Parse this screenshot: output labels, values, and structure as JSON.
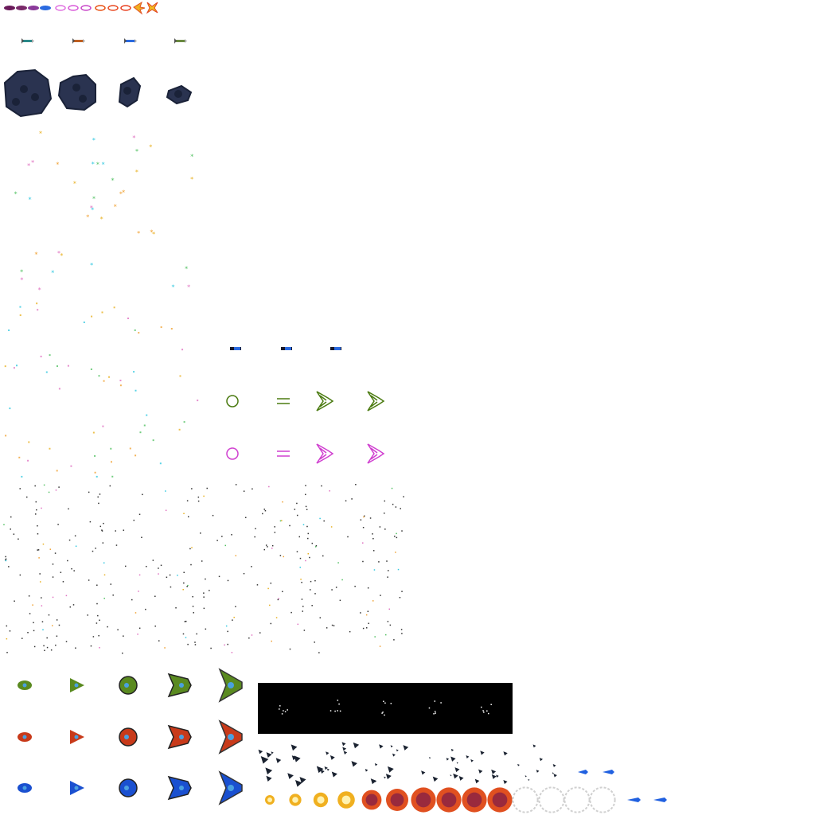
{
  "sheet": {
    "title": "",
    "background": "#ffffff"
  },
  "projectiles_top": {
    "colors": [
      "#6a1a5a",
      "#7a2a6a",
      "#8a3a9a",
      "#2a6ae0",
      "#e070e0",
      "#d858d8",
      "#c848c8",
      "#e85010",
      "#e84820",
      "#e84020"
    ],
    "count": 12,
    "icons": [
      "bolt-purple-icon",
      "bolt-blue-icon",
      "ring-pink-icon",
      "ring-red-icon",
      "flame-burst-icon",
      "spark-burst-icon"
    ]
  },
  "missiles": {
    "count": 4,
    "colors": [
      "#2a8a8a",
      "#c06020",
      "#2a6ae0",
      "#6a8a40"
    ]
  },
  "asteroids": {
    "count": 4,
    "color": "#2a3350",
    "shade": "#1a2238"
  },
  "stars": {
    "colors": [
      "#e8b020",
      "#e070c0",
      "#30c8e0",
      "#50c060",
      "#f0a030"
    ]
  },
  "beams": {
    "count": 3
  },
  "shields": {
    "green": {
      "color": "#4a7a10",
      "items": [
        "ring-icon",
        "dash-icon",
        "wing-icon",
        "wing-icon"
      ]
    },
    "magenta": {
      "color": "#d040d0",
      "items": [
        "ring-icon",
        "dash-icon",
        "wing-icon",
        "wing-icon"
      ]
    }
  },
  "enemy_ships": {
    "rows": [
      {
        "name": "green",
        "color": "#5a8a20"
      },
      {
        "name": "red",
        "color": "#c83a1a"
      },
      {
        "name": "blue",
        "color": "#1a50d0"
      }
    ],
    "variants": 5
  },
  "black_panel": {
    "color": "#000000",
    "frames": 5
  },
  "debris": {
    "frames": 6,
    "color": "#1a2230"
  },
  "explosion": {
    "frames": 14,
    "colors": [
      "#f0b020",
      "#e05020",
      "#7a1a4a",
      "#d0d0d0"
    ]
  },
  "thrusters": {
    "count": 4,
    "color": "#2060e0"
  }
}
